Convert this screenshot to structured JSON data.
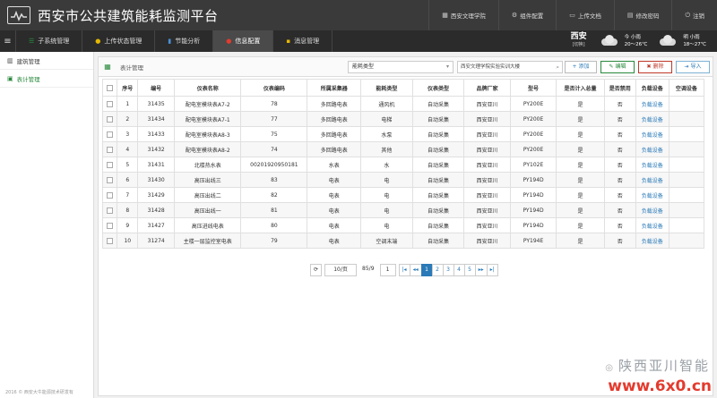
{
  "header": {
    "title": "西安市公共建筑能耗监测平台",
    "links": [
      {
        "icon": "building-icon",
        "label": "西安文理学院"
      },
      {
        "icon": "settings-icon",
        "label": "组件配置"
      },
      {
        "icon": "upload-icon",
        "label": "上传文档"
      },
      {
        "icon": "password-icon",
        "label": "修改密码"
      },
      {
        "icon": "power-icon",
        "label": "注销"
      }
    ]
  },
  "nav": {
    "tabs": [
      "子系统管理",
      "上传状态管理",
      "节能分析",
      "信息配置",
      "消息管理"
    ],
    "active": "信息配置"
  },
  "weather": {
    "city": "西安",
    "city_sub": "[切换]",
    "today": {
      "day": "今",
      "cond": "小雨",
      "temp": "20～26℃"
    },
    "tomorrow": {
      "day": "明",
      "cond": "小雨",
      "temp": "18～27℃"
    }
  },
  "sidebar": {
    "items": [
      "建筑管理",
      "表计管理"
    ],
    "footer": "2016 © 西安大牛能源技术研发有"
  },
  "toolbar": {
    "title": "表计管理",
    "select_value": "能耗类型",
    "search_value": "西安文理学院实验实训大楼",
    "add": "添加",
    "edit": "编辑",
    "delete": "删除",
    "import": "导入"
  },
  "table": {
    "headers": [
      "序号",
      "编号",
      "仪表名称",
      "仪表编码",
      "所属采集器",
      "能耗类型",
      "仪表类型",
      "品牌厂家",
      "型号",
      "是否计入总量",
      "是否禁用",
      "负载设备",
      "空调设备"
    ],
    "rows": [
      [
        "1",
        "31435",
        "配电室模块表A7-2",
        "78",
        "多回路电表",
        "通风机",
        "自动采集",
        "西安亚川",
        "PY200E",
        "是",
        "否",
        "负载设备",
        ""
      ],
      [
        "2",
        "31434",
        "配电室模块表A7-1",
        "77",
        "多回路电表",
        "电梯",
        "自动采集",
        "西安亚川",
        "PY200E",
        "是",
        "否",
        "负载设备",
        ""
      ],
      [
        "3",
        "31433",
        "配电室模块表A8-3",
        "75",
        "多回路电表",
        "水泵",
        "自动采集",
        "西安亚川",
        "PY200E",
        "是",
        "否",
        "负载设备",
        ""
      ],
      [
        "4",
        "31432",
        "配电室模块表A8-2",
        "74",
        "多回路电表",
        "其他",
        "自动采集",
        "西安亚川",
        "PY200E",
        "是",
        "否",
        "负载设备",
        ""
      ],
      [
        "5",
        "31431",
        "北楼热水表",
        "00201920950181",
        "水表",
        "水",
        "自动采集",
        "西安亚川",
        "PY102E",
        "是",
        "否",
        "负载设备",
        ""
      ],
      [
        "6",
        "31430",
        "高压出线三",
        "83",
        "电表",
        "电",
        "自动采集",
        "西安亚川",
        "PY194D",
        "是",
        "否",
        "负载设备",
        ""
      ],
      [
        "7",
        "31429",
        "高压出线二",
        "82",
        "电表",
        "电",
        "自动采集",
        "西安亚川",
        "PY194D",
        "是",
        "否",
        "负载设备",
        ""
      ],
      [
        "8",
        "31428",
        "高压出线一",
        "81",
        "电表",
        "电",
        "自动采集",
        "西安亚川",
        "PY194D",
        "是",
        "否",
        "负载设备",
        ""
      ],
      [
        "9",
        "31427",
        "高压进线电表",
        "80",
        "电表",
        "电",
        "自动采集",
        "西安亚川",
        "PY194D",
        "是",
        "否",
        "负载设备",
        ""
      ],
      [
        "10",
        "31274",
        "主楼一层监控室电表",
        "79",
        "电表",
        "空调末端",
        "自动采集",
        "西安亚川",
        "PY194E",
        "是",
        "否",
        "负载设备",
        ""
      ]
    ]
  },
  "pager": {
    "page_size": "10/页",
    "page_info": "85/9",
    "jump_value": "1",
    "pages": [
      "1",
      "2",
      "3",
      "4",
      "5"
    ],
    "current": "1"
  },
  "watermark": {
    "text": "陕西亚川智能",
    "url": "www.6x0.cn"
  },
  "colors": {
    "accent_green": "#2a8a3e",
    "link_blue": "#2a7ab8",
    "danger_red": "#c0392b",
    "header_dark": "#3a3a3a"
  }
}
